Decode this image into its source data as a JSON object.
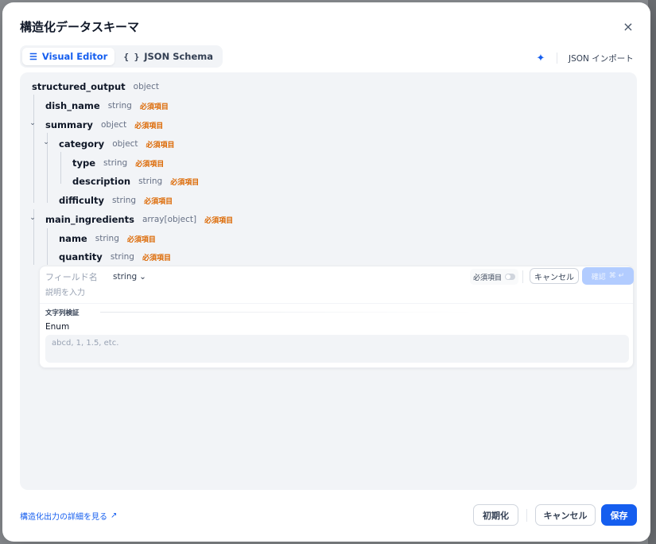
{
  "modal": {
    "title": "構造化データスキーマ",
    "close_icon": "×"
  },
  "tabs": [
    {
      "label": "Visual Editor",
      "icon": "☰",
      "active": true
    },
    {
      "label": "JSON Schema",
      "icon": "{ }",
      "active": false
    }
  ],
  "toolbar": {
    "magic_icon": "✦",
    "import_label": "JSON インポート"
  },
  "schema": {
    "required_label": "必須項目",
    "chevron_icon": "⌄",
    "root": {
      "name": "structured_output",
      "type": "object"
    },
    "fields": [
      {
        "name": "dish_name",
        "type": "string"
      },
      {
        "name": "summary",
        "type": "object"
      },
      {
        "name": "category",
        "type": "object"
      },
      {
        "name": "type",
        "type": "string"
      },
      {
        "name": "description",
        "type": "string"
      },
      {
        "name": "difficulty",
        "type": "string"
      },
      {
        "name": "main_ingredients",
        "type": "array[object]"
      },
      {
        "name": "name",
        "type": "string"
      },
      {
        "name": "quantity",
        "type": "string"
      }
    ]
  },
  "field_form": {
    "name_placeholder": "フィールド名",
    "type_value": "string",
    "type_chevron": "⌄",
    "required_label": "必須項目",
    "cancel_label": "キャンセル",
    "confirm_label": "確認",
    "confirm_icon": "⌘ ↵",
    "description_placeholder": "説明を入力",
    "section_label": "文字列検証",
    "enum_label": "Enum",
    "enum_placeholder": "abcd, 1, 1.5, etc."
  },
  "footer": {
    "docs_link": "構造化出力の詳細を見る",
    "external_icon": "↗",
    "reset_label": "初期化",
    "cancel_label": "キャンセル",
    "save_label": "保存"
  }
}
